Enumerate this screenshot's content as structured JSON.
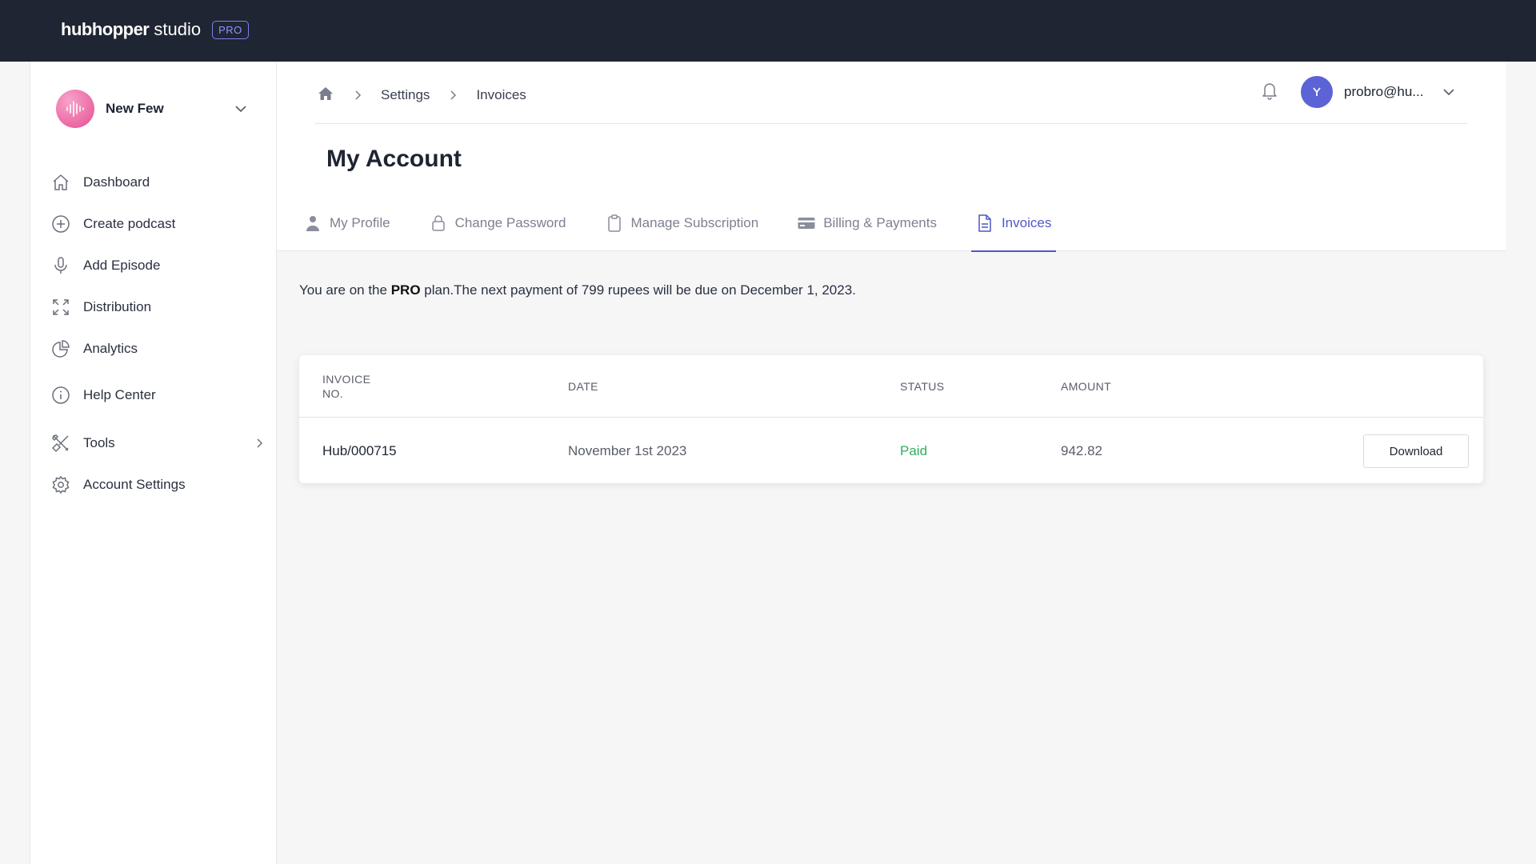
{
  "app": {
    "brand_bold": "hubhopper",
    "brand_light": "studio",
    "plan_badge": "PRO"
  },
  "sidebar": {
    "podcast_name": "New Few",
    "items": [
      {
        "label": "Dashboard",
        "icon": "home-icon"
      },
      {
        "label": "Create podcast",
        "icon": "plus-circle-icon"
      },
      {
        "label": "Add Episode",
        "icon": "microphone-icon"
      },
      {
        "label": "Distribution",
        "icon": "expand-arrows-icon"
      },
      {
        "label": "Analytics",
        "icon": "pie-chart-icon"
      },
      {
        "label": "Help Center",
        "icon": "info-icon"
      },
      {
        "label": "Tools",
        "icon": "tools-icon"
      },
      {
        "label": "Account Settings",
        "icon": "gear-icon"
      }
    ]
  },
  "header": {
    "breadcrumb": [
      "Settings",
      "Invoices"
    ],
    "user_email": "probro@hu...",
    "page_title": "My Account"
  },
  "tabs": [
    {
      "label": "My Profile",
      "icon": "user-icon"
    },
    {
      "label": "Change Password",
      "icon": "lock-icon"
    },
    {
      "label": "Manage Subscription",
      "icon": "clipboard-icon"
    },
    {
      "label": "Billing & Payments",
      "icon": "credit-card-icon"
    },
    {
      "label": "Invoices",
      "icon": "document-icon",
      "active": true
    }
  ],
  "plan": {
    "prefix": "You are on the ",
    "plan_name": "PRO",
    "suffix": " plan.The next payment of 799 rupees will be due on December 1, 2023."
  },
  "table": {
    "headers": {
      "invoice_line1": "INVOICE",
      "invoice_line2": "NO.",
      "date": "DATE",
      "status": "STATUS",
      "amount": "AMOUNT"
    },
    "rows": [
      {
        "invoice_no": "Hub/000715",
        "date": "November 1st 2023",
        "status": "Paid",
        "amount": "942.82",
        "action": "Download"
      }
    ]
  },
  "colors": {
    "topbar": "#1f2533",
    "accent": "#4f57c9",
    "paid": "#2fae5f"
  }
}
